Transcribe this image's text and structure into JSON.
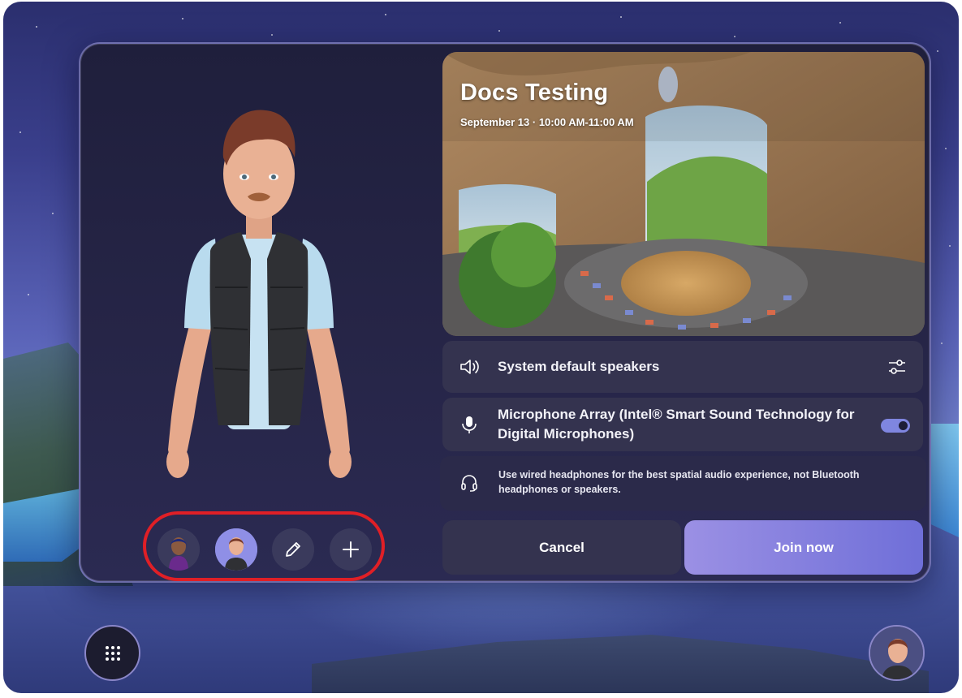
{
  "meeting": {
    "title": "Docs Testing",
    "datetime": "September 13 · 10:00 AM-11:00 AM"
  },
  "audio": {
    "speaker_label": "System default speakers",
    "microphone_label": "Microphone Array (Intel® Smart Sound Technology for Digital Microphones)",
    "microphone_enabled": true,
    "tip": "Use wired headphones for the best spatial audio experience, not Bluetooth headphones or speakers."
  },
  "actions": {
    "cancel_label": "Cancel",
    "join_label": "Join now"
  },
  "avatar_picker": {
    "items": [
      "avatar-option-1",
      "avatar-option-2-selected",
      "edit-avatar",
      "add-avatar"
    ]
  },
  "icons": {
    "speaker": "speaker-icon",
    "settings": "sliders-icon",
    "microphone": "microphone-icon",
    "headset": "headset-icon",
    "edit": "pencil-icon",
    "add": "plus-icon",
    "apps": "app-grid-icon"
  },
  "colors": {
    "highlight": "#e01f26",
    "join_button": "#8f8fe6",
    "panel": "#23233f"
  }
}
